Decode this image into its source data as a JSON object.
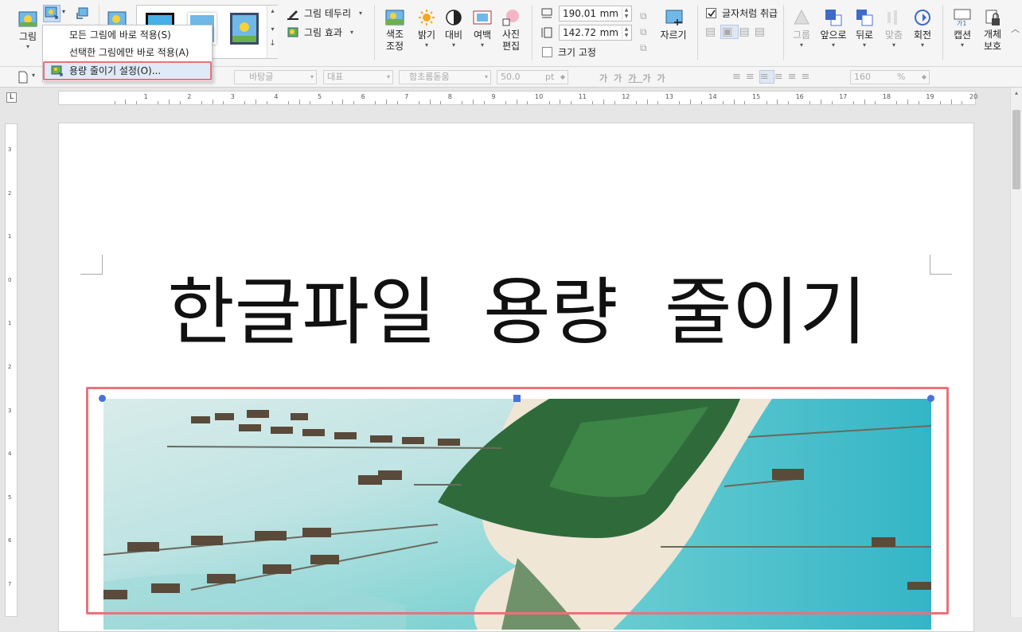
{
  "ribbon": {
    "picture": "그림",
    "border": "그림 테두리",
    "effect": "그림 효과",
    "color_adjust_1": "색조",
    "color_adjust_2": "조정",
    "brightness": "밝기",
    "contrast": "대비",
    "margin": "여백",
    "photo_edit_1": "사진",
    "photo_edit_2": "편집",
    "width_value": "190.01",
    "height_value": "142.72",
    "unit": "mm",
    "size_fix": "크기 고정",
    "crop": "자르기",
    "treat_as_char": "글자처럼 취급",
    "group": "그룹",
    "bring_forward": "앞으로",
    "send_backward": "뒤로",
    "align": "맞춤",
    "rotate": "회전",
    "caption": "캡션",
    "protect_1": "개체",
    "protect_2": "보호"
  },
  "dropdown": {
    "items": [
      {
        "label": "모든 그림에 바로 적용(S)"
      },
      {
        "label": "선택한 그림에만 바로 적용(A)"
      },
      {
        "label": "용량 줄이기 설정(O)..."
      }
    ]
  },
  "toolbar2": {
    "style": "바탕글",
    "font_lang": "대표",
    "font": "함초롬돋움",
    "font_size": "50.0",
    "font_unit": "pt",
    "zoom": "160",
    "zoom_unit": "%",
    "bold": "가",
    "italic": "가",
    "underline": "가",
    "color": "가",
    "highlight": "가"
  },
  "ruler": {
    "h_ticks": [
      "1",
      "2",
      "3",
      "4",
      "5",
      "6",
      "7",
      "8",
      "9",
      "10",
      "11",
      "12",
      "13",
      "14",
      "15",
      "16",
      "17",
      "18",
      "19",
      "20"
    ],
    "v_ticks": [
      "3",
      "2",
      "1",
      "0",
      "1",
      "2",
      "3",
      "4",
      "5",
      "6",
      "7"
    ]
  },
  "document": {
    "title": "한글파일  용량  줄이기"
  },
  "colors": {
    "highlight": "#e8737a",
    "handle": "#4a72d8",
    "sea": "#7fd3d3"
  }
}
